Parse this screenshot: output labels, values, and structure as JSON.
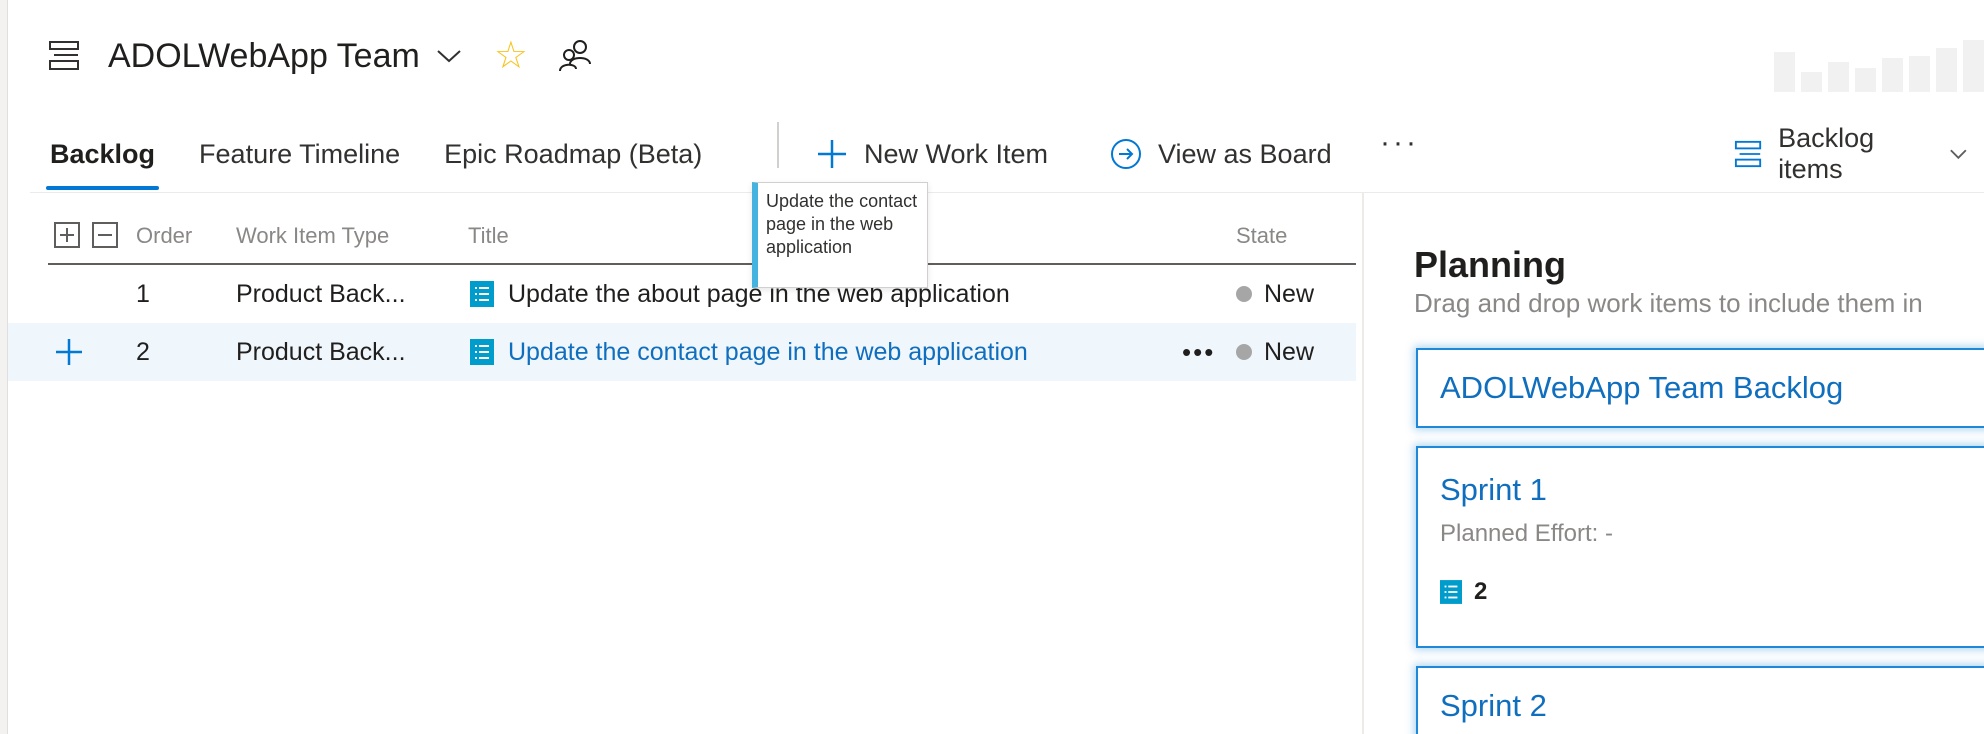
{
  "header": {
    "team_name": "ADOLWebApp Team",
    "icons": [
      "backlog-icon",
      "chevron-down-icon",
      "star-icon",
      "people-icon"
    ],
    "star_color": "#f8c421"
  },
  "tabs": [
    {
      "label": "Backlog",
      "active": true
    },
    {
      "label": "Feature Timeline",
      "active": false
    },
    {
      "label": "Epic Roadmap (Beta)",
      "active": false
    }
  ],
  "toolbar": {
    "new_work_item": "New Work Item",
    "view_as_board": "View as Board",
    "more": "···",
    "backlog_level": "Backlog items"
  },
  "grid": {
    "columns": {
      "order": "Order",
      "type": "Work Item Type",
      "title": "Title",
      "state": "State"
    },
    "rows": [
      {
        "order": "1",
        "type": "Product Back...",
        "title": "Update the about page in the web application",
        "state": "New",
        "selected": false
      },
      {
        "order": "2",
        "type": "Product Back...",
        "title": "Update the contact page in the web application",
        "state": "New",
        "selected": true
      }
    ],
    "row_more": "•••"
  },
  "tooltip": {
    "text": "Update the contact page in the web application"
  },
  "planning": {
    "title": "Planning",
    "subtitle": "Drag and drop work items to include them in",
    "cards": [
      {
        "title": "ADOLWebApp Team Backlog"
      },
      {
        "title": "Sprint 1",
        "planned_effort": "Planned Effort: -",
        "count": "2"
      },
      {
        "title": "Sprint 2"
      }
    ]
  },
  "colors": {
    "accent": "#0078d4",
    "link": "#106ebe",
    "work_item_icon": "#009ccc",
    "selected_row": "#eff6fc"
  }
}
